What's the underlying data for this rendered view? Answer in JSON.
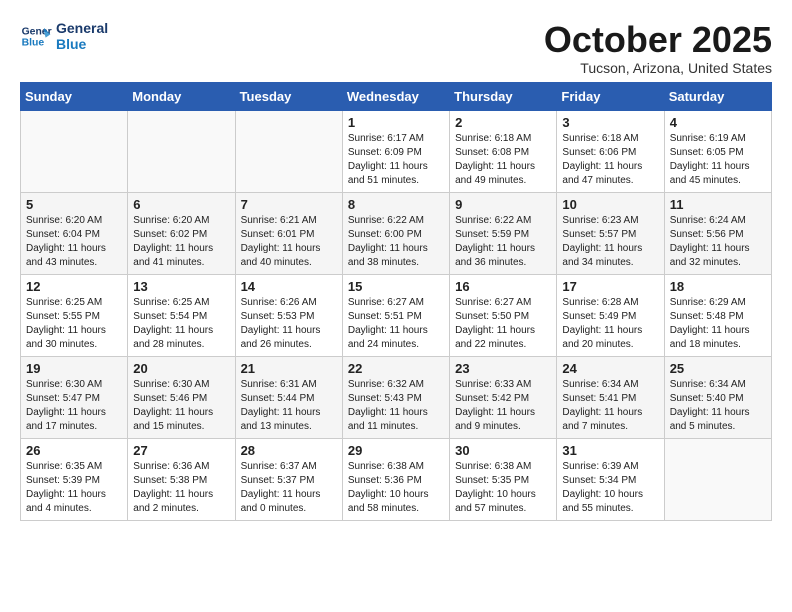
{
  "logo": {
    "line1": "General",
    "line2": "Blue"
  },
  "title": "October 2025",
  "location": "Tucson, Arizona, United States",
  "weekdays": [
    "Sunday",
    "Monday",
    "Tuesday",
    "Wednesday",
    "Thursday",
    "Friday",
    "Saturday"
  ],
  "weeks": [
    [
      {
        "day": "",
        "info": ""
      },
      {
        "day": "",
        "info": ""
      },
      {
        "day": "",
        "info": ""
      },
      {
        "day": "1",
        "info": "Sunrise: 6:17 AM\nSunset: 6:09 PM\nDaylight: 11 hours\nand 51 minutes."
      },
      {
        "day": "2",
        "info": "Sunrise: 6:18 AM\nSunset: 6:08 PM\nDaylight: 11 hours\nand 49 minutes."
      },
      {
        "day": "3",
        "info": "Sunrise: 6:18 AM\nSunset: 6:06 PM\nDaylight: 11 hours\nand 47 minutes."
      },
      {
        "day": "4",
        "info": "Sunrise: 6:19 AM\nSunset: 6:05 PM\nDaylight: 11 hours\nand 45 minutes."
      }
    ],
    [
      {
        "day": "5",
        "info": "Sunrise: 6:20 AM\nSunset: 6:04 PM\nDaylight: 11 hours\nand 43 minutes."
      },
      {
        "day": "6",
        "info": "Sunrise: 6:20 AM\nSunset: 6:02 PM\nDaylight: 11 hours\nand 41 minutes."
      },
      {
        "day": "7",
        "info": "Sunrise: 6:21 AM\nSunset: 6:01 PM\nDaylight: 11 hours\nand 40 minutes."
      },
      {
        "day": "8",
        "info": "Sunrise: 6:22 AM\nSunset: 6:00 PM\nDaylight: 11 hours\nand 38 minutes."
      },
      {
        "day": "9",
        "info": "Sunrise: 6:22 AM\nSunset: 5:59 PM\nDaylight: 11 hours\nand 36 minutes."
      },
      {
        "day": "10",
        "info": "Sunrise: 6:23 AM\nSunset: 5:57 PM\nDaylight: 11 hours\nand 34 minutes."
      },
      {
        "day": "11",
        "info": "Sunrise: 6:24 AM\nSunset: 5:56 PM\nDaylight: 11 hours\nand 32 minutes."
      }
    ],
    [
      {
        "day": "12",
        "info": "Sunrise: 6:25 AM\nSunset: 5:55 PM\nDaylight: 11 hours\nand 30 minutes."
      },
      {
        "day": "13",
        "info": "Sunrise: 6:25 AM\nSunset: 5:54 PM\nDaylight: 11 hours\nand 28 minutes."
      },
      {
        "day": "14",
        "info": "Sunrise: 6:26 AM\nSunset: 5:53 PM\nDaylight: 11 hours\nand 26 minutes."
      },
      {
        "day": "15",
        "info": "Sunrise: 6:27 AM\nSunset: 5:51 PM\nDaylight: 11 hours\nand 24 minutes."
      },
      {
        "day": "16",
        "info": "Sunrise: 6:27 AM\nSunset: 5:50 PM\nDaylight: 11 hours\nand 22 minutes."
      },
      {
        "day": "17",
        "info": "Sunrise: 6:28 AM\nSunset: 5:49 PM\nDaylight: 11 hours\nand 20 minutes."
      },
      {
        "day": "18",
        "info": "Sunrise: 6:29 AM\nSunset: 5:48 PM\nDaylight: 11 hours\nand 18 minutes."
      }
    ],
    [
      {
        "day": "19",
        "info": "Sunrise: 6:30 AM\nSunset: 5:47 PM\nDaylight: 11 hours\nand 17 minutes."
      },
      {
        "day": "20",
        "info": "Sunrise: 6:30 AM\nSunset: 5:46 PM\nDaylight: 11 hours\nand 15 minutes."
      },
      {
        "day": "21",
        "info": "Sunrise: 6:31 AM\nSunset: 5:44 PM\nDaylight: 11 hours\nand 13 minutes."
      },
      {
        "day": "22",
        "info": "Sunrise: 6:32 AM\nSunset: 5:43 PM\nDaylight: 11 hours\nand 11 minutes."
      },
      {
        "day": "23",
        "info": "Sunrise: 6:33 AM\nSunset: 5:42 PM\nDaylight: 11 hours\nand 9 minutes."
      },
      {
        "day": "24",
        "info": "Sunrise: 6:34 AM\nSunset: 5:41 PM\nDaylight: 11 hours\nand 7 minutes."
      },
      {
        "day": "25",
        "info": "Sunrise: 6:34 AM\nSunset: 5:40 PM\nDaylight: 11 hours\nand 5 minutes."
      }
    ],
    [
      {
        "day": "26",
        "info": "Sunrise: 6:35 AM\nSunset: 5:39 PM\nDaylight: 11 hours\nand 4 minutes."
      },
      {
        "day": "27",
        "info": "Sunrise: 6:36 AM\nSunset: 5:38 PM\nDaylight: 11 hours\nand 2 minutes."
      },
      {
        "day": "28",
        "info": "Sunrise: 6:37 AM\nSunset: 5:37 PM\nDaylight: 11 hours\nand 0 minutes."
      },
      {
        "day": "29",
        "info": "Sunrise: 6:38 AM\nSunset: 5:36 PM\nDaylight: 10 hours\nand 58 minutes."
      },
      {
        "day": "30",
        "info": "Sunrise: 6:38 AM\nSunset: 5:35 PM\nDaylight: 10 hours\nand 57 minutes."
      },
      {
        "day": "31",
        "info": "Sunrise: 6:39 AM\nSunset: 5:34 PM\nDaylight: 10 hours\nand 55 minutes."
      },
      {
        "day": "",
        "info": ""
      }
    ]
  ]
}
